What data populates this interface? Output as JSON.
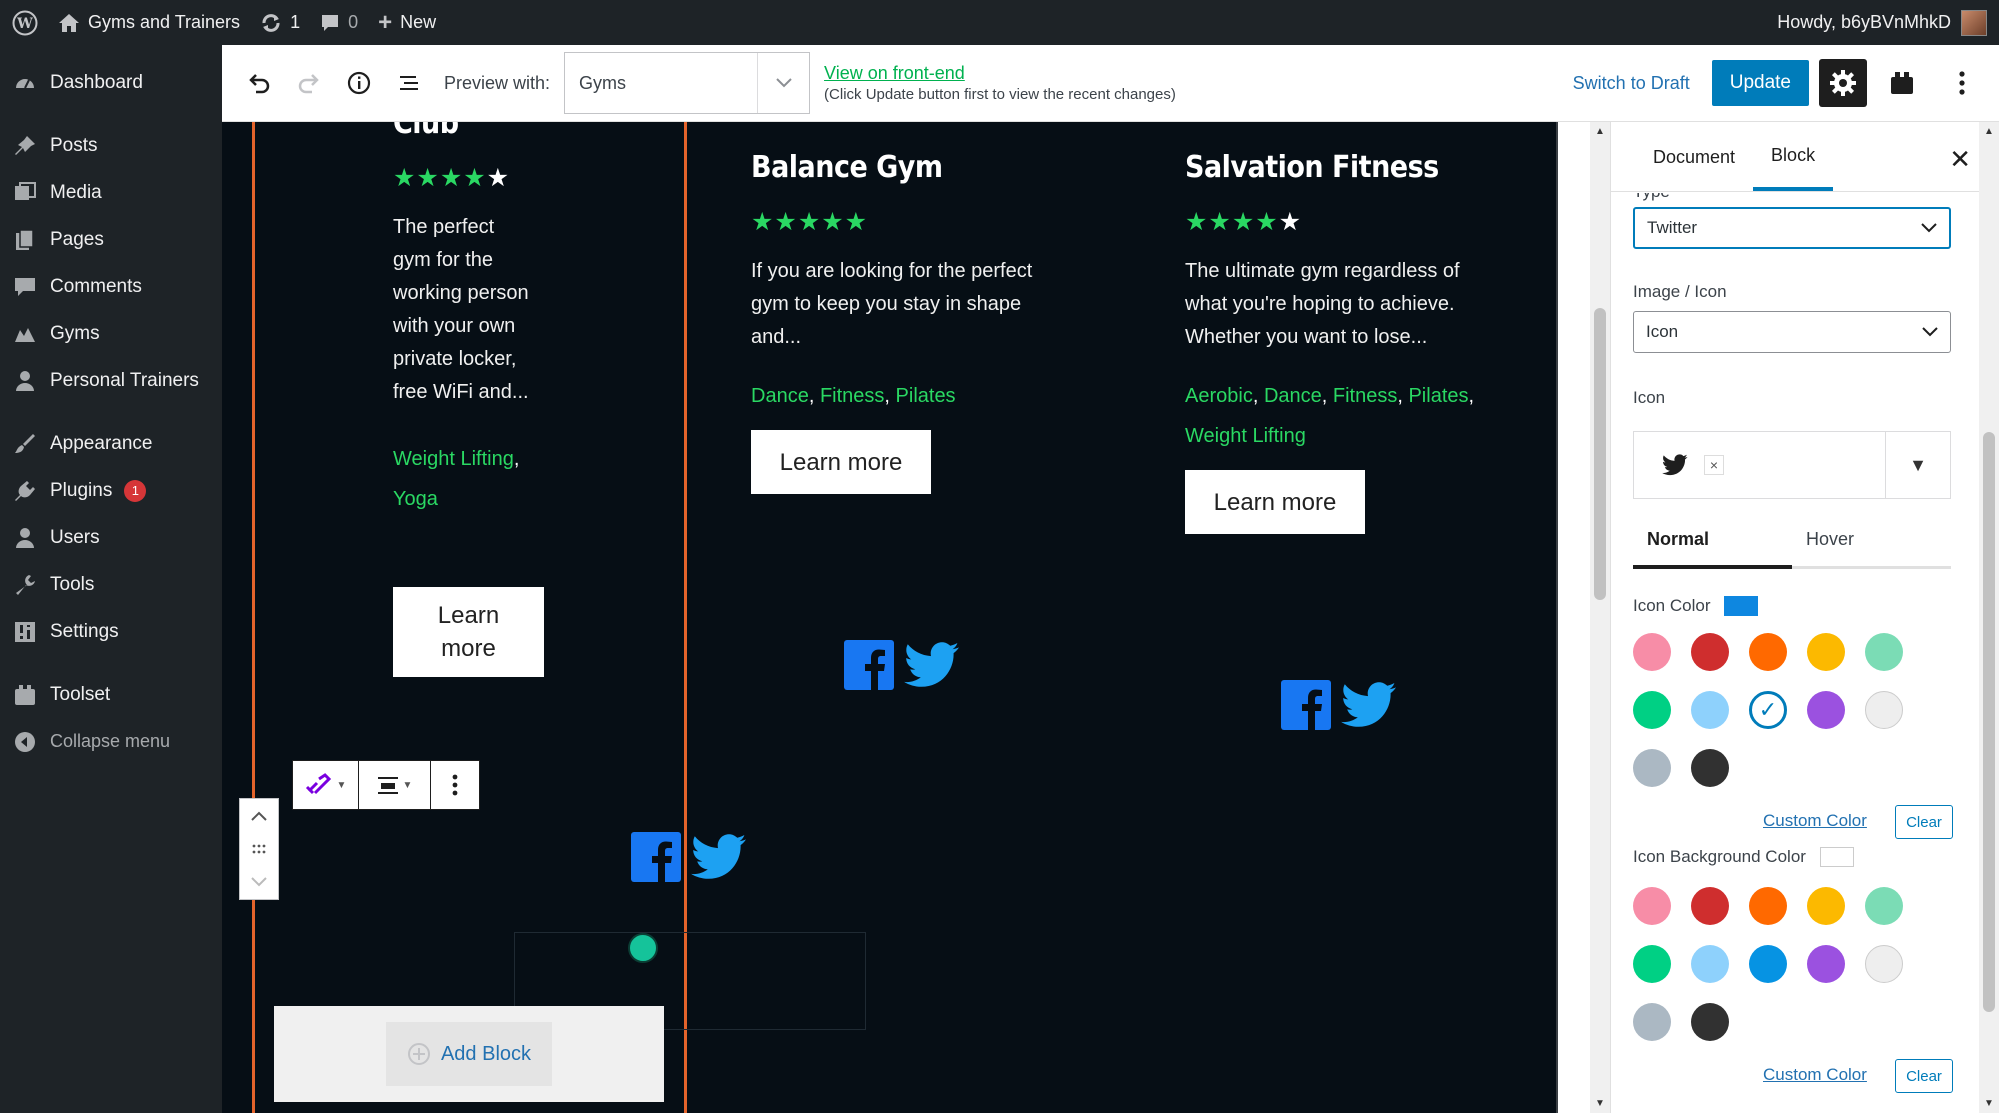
{
  "adminbar": {
    "site_name": "Gyms and Trainers",
    "updates_count": "1",
    "comments_count": "0",
    "new_label": "New",
    "howdy": "Howdy, b6yBVnMhkD"
  },
  "sidebar": {
    "items": [
      {
        "label": "Dashboard",
        "icon": "dashboard-icon"
      },
      {
        "label": "Posts",
        "icon": "pin-icon"
      },
      {
        "label": "Media",
        "icon": "media-icon"
      },
      {
        "label": "Pages",
        "icon": "pages-icon"
      },
      {
        "label": "Comments",
        "icon": "comment-icon"
      },
      {
        "label": "Gyms",
        "icon": "gym-icon"
      },
      {
        "label": "Personal Trainers",
        "icon": "person-icon"
      },
      {
        "label": "Appearance",
        "icon": "brush-icon"
      },
      {
        "label": "Plugins",
        "icon": "plug-icon",
        "badge": "1"
      },
      {
        "label": "Users",
        "icon": "users-icon"
      },
      {
        "label": "Tools",
        "icon": "wrench-icon"
      },
      {
        "label": "Settings",
        "icon": "settings-icon"
      },
      {
        "label": "Toolset",
        "icon": "toolset-icon"
      }
    ],
    "collapse_label": "Collapse menu"
  },
  "toolbar": {
    "preview_label": "Preview with:",
    "preview_value": "Gyms",
    "frontend_link": "View on front-end",
    "frontend_note": "(Click Update button first to view the recent changes)",
    "switch_draft": "Switch to Draft",
    "update": "Update"
  },
  "content": {
    "col1": {
      "title": "Club",
      "stars": "★★★★",
      "stars_half": "★",
      "description": [
        "The perfect",
        "gym for the",
        "working person",
        "with your own",
        "private locker,",
        "free WiFi and..."
      ],
      "tags": [
        "Weight Lifting",
        "Yoga"
      ],
      "button": [
        "Learn",
        "more"
      ]
    },
    "col2": {
      "title": "Balance Gym",
      "stars": "★★★★★",
      "description": [
        "If you are looking for the perfect",
        "gym to keep you stay in shape",
        "and..."
      ],
      "tags": [
        "Dance",
        "Fitness",
        "Pilates"
      ],
      "button": "Learn more"
    },
    "col3": {
      "title": "Salvation Fitness",
      "stars": "★★★★",
      "stars_half": "★",
      "description": [
        "The ultimate gym regardless of",
        "what you're hoping to achieve.",
        "Whether you want to lose..."
      ],
      "tags_line1": [
        "Aerobic",
        "Dance",
        "Fitness",
        "Pilates"
      ],
      "tags_line2": [
        "Weight Lifting"
      ],
      "button": "Learn more"
    },
    "add_block": "Add Block"
  },
  "panel": {
    "tabs": [
      "Document",
      "Block"
    ],
    "active_tab": "Block",
    "type_label": "Type",
    "type_value": "Twitter",
    "image_icon_label": "Image / Icon",
    "image_icon_value": "Icon",
    "icon_label": "Icon",
    "state_tabs": [
      "Normal",
      "Hover"
    ],
    "icon_color_label": "Icon Color",
    "icon_color_value": "#0e87e0",
    "icon_bg_label": "Icon Background Color",
    "custom_color": "Custom Color",
    "clear": "Clear",
    "palette": [
      "#f78da7",
      "#cf2e2e",
      "#ff6900",
      "#fcb900",
      "#7bdcb5",
      "#00d084",
      "#8ed1fc",
      "#0693e3",
      "#9b51e0",
      "#eeeeee",
      "#abb8c3",
      "#313131"
    ]
  },
  "colors": {
    "green": "#2ad863",
    "orange_line": "#e3632b",
    "facebook": "#1877f2",
    "twitter": "#1da1f2",
    "wp_blue": "#007cba"
  }
}
